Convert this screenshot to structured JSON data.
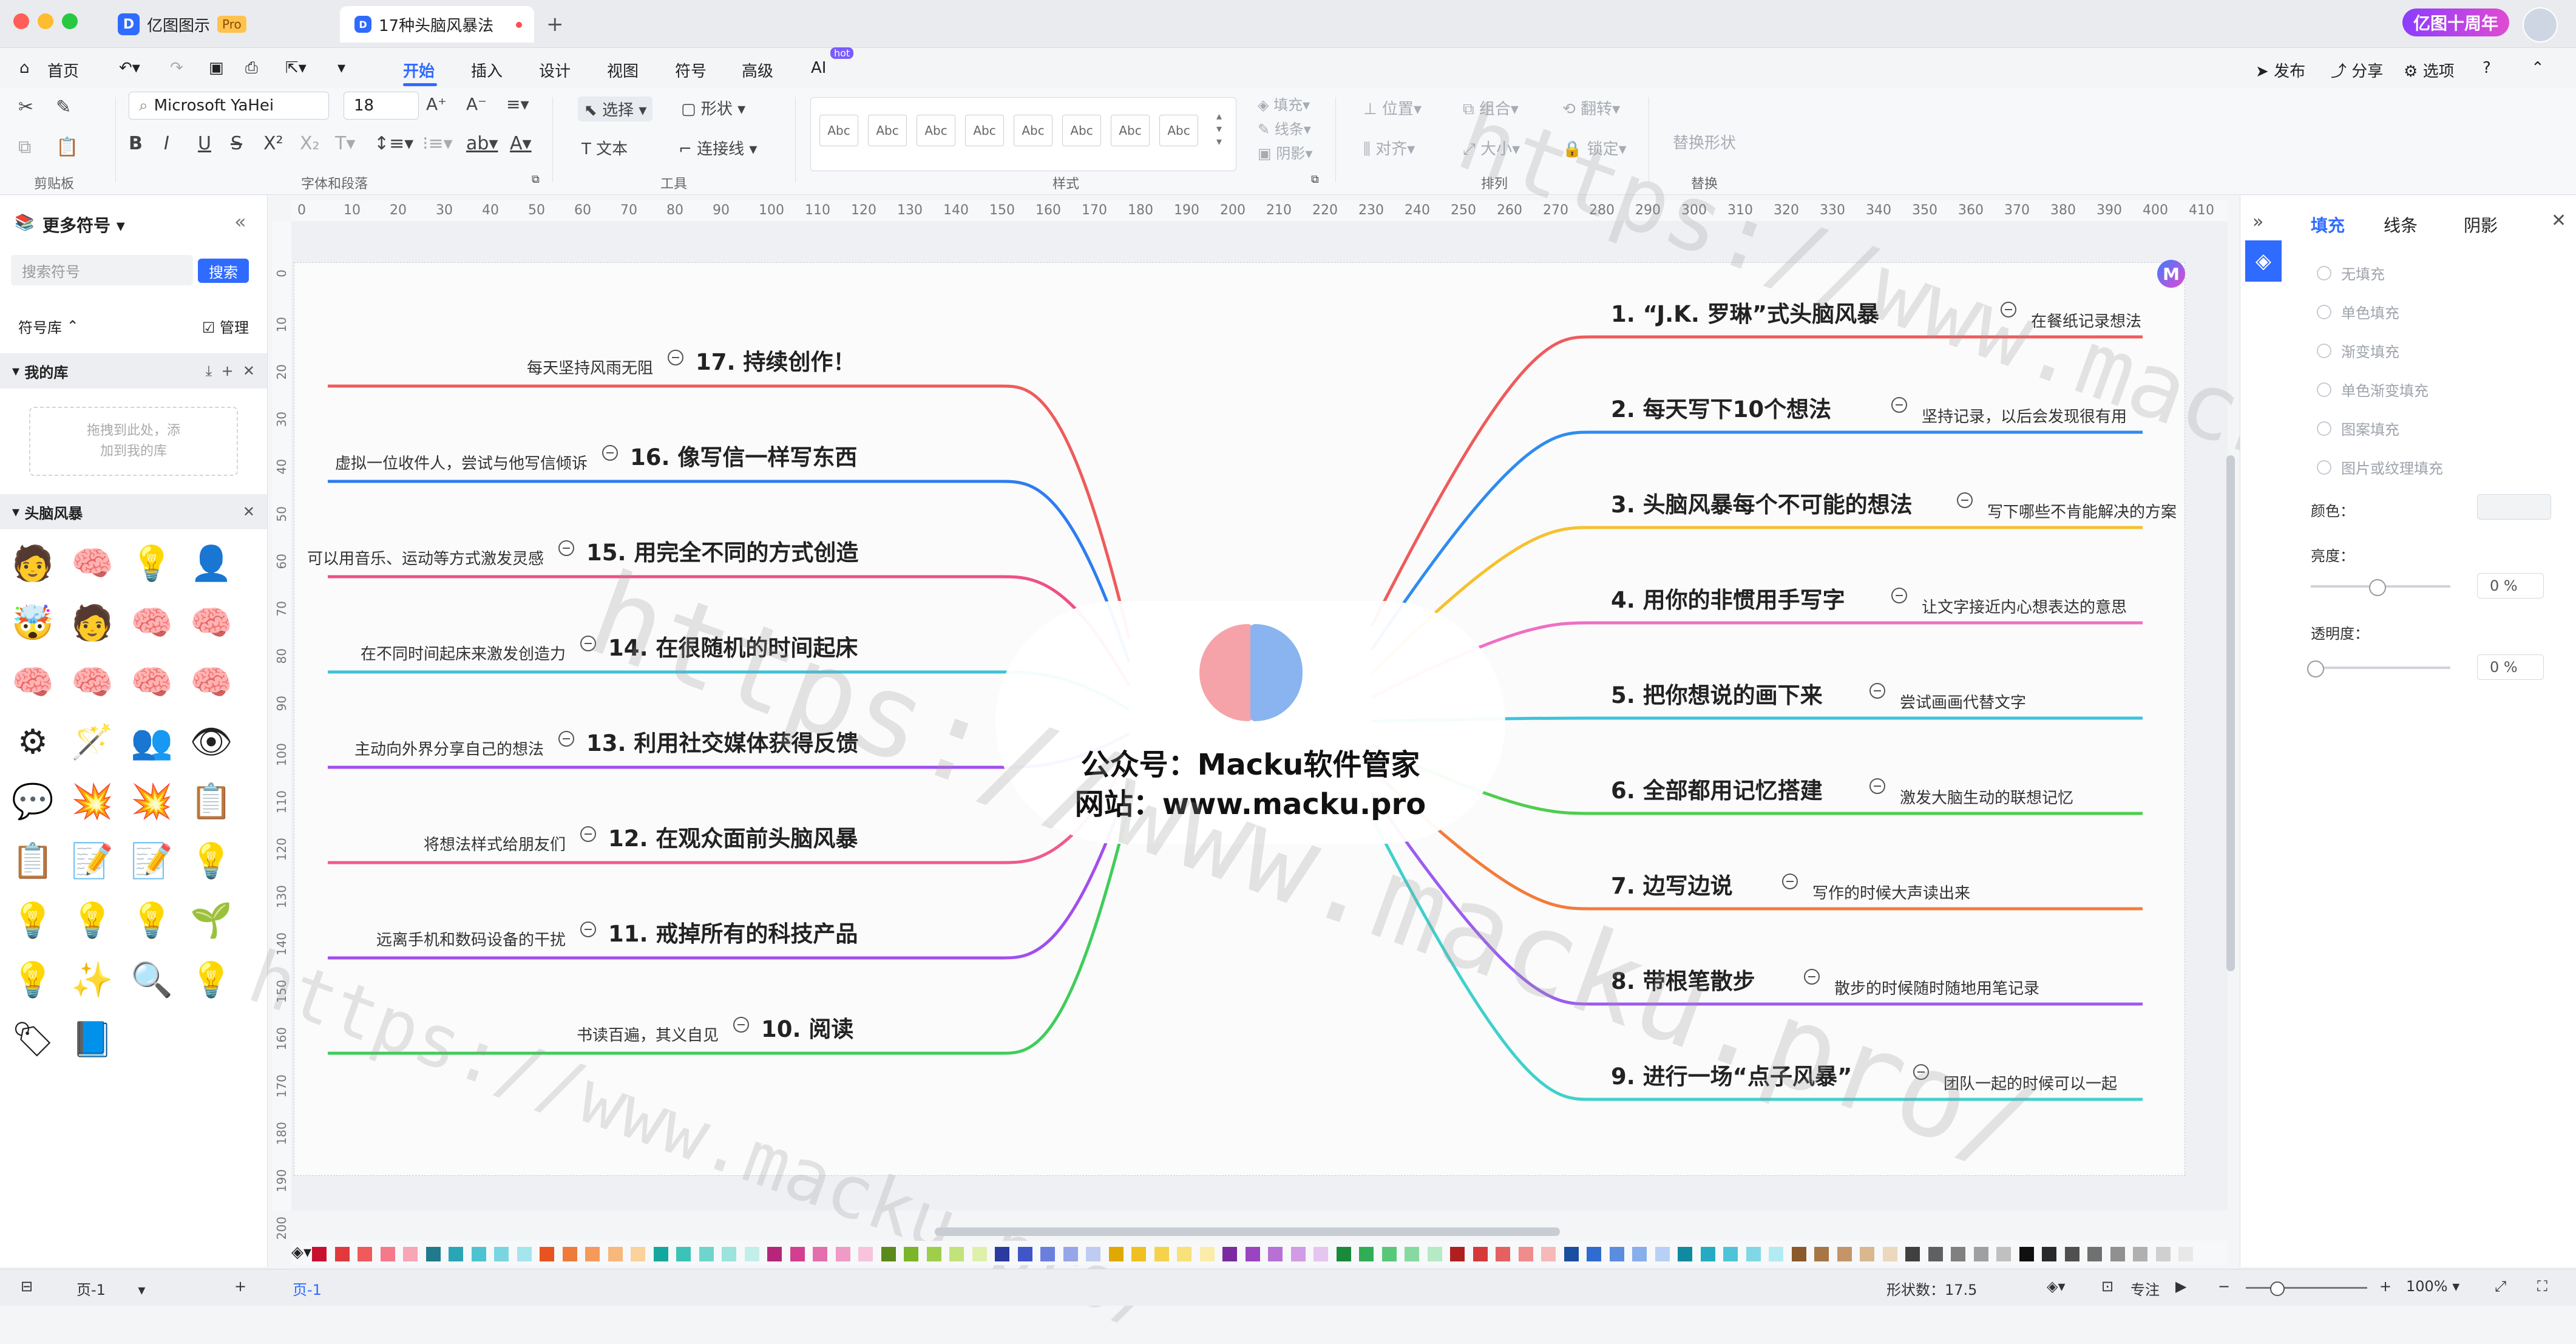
{
  "titlebar": {
    "app_tab": "亿图图示",
    "app_badge": "Pro",
    "doc_tab": "17种头脑风暴法",
    "new_tab": "+",
    "anniversary": "亿图十周年"
  },
  "menu": {
    "home": "首页",
    "tabs": [
      "开始",
      "插入",
      "设计",
      "视图",
      "符号",
      "高级",
      "AI"
    ],
    "ai_badge": "hot",
    "publish": "发布",
    "share": "分享",
    "options": "选项",
    "help": "?"
  },
  "ribbon": {
    "groups": {
      "clipboard": "剪贴板",
      "font_para": "字体和段落",
      "tools": "工具",
      "styles": "样式",
      "arrange": "排列",
      "replace": "替换"
    },
    "font_name": "Microsoft YaHei",
    "font_size": "18",
    "tools": {
      "select": "选择",
      "shape": "形状",
      "text": "文本",
      "connector": "连接线"
    },
    "style_sample": "Abc",
    "fill": "填充",
    "line": "线条",
    "shadow": "阴影",
    "position": "位置",
    "group": "组合",
    "rotate": "翻转",
    "align": "对齐",
    "size": "大小",
    "lock": "锁定",
    "replace_shape": "替换形状"
  },
  "left_panel": {
    "title": "更多符号",
    "search_placeholder": "搜索符号",
    "search_button": "搜索",
    "library": "符号库",
    "manage": "管理",
    "my_library": "我的库",
    "drop_hint_1": "拖拽到此处，添",
    "drop_hint_2": "加到我的库",
    "category": "头脑风暴",
    "symbols": [
      "🧑",
      "🧠",
      "💡",
      "👤",
      "🤯",
      "🧑",
      "🧠",
      "🧠",
      "🧠",
      "🧠",
      "🧠",
      "🧠",
      "⚙",
      "🪄",
      "👥",
      "👁",
      "💬",
      "💥",
      "💥",
      "📋",
      "📋",
      "📝",
      "📝",
      "💡",
      "💡",
      "💡",
      "💡",
      "🌱",
      "💡",
      "✨",
      "🔍",
      "💡",
      "🏷",
      "📘"
    ]
  },
  "ruler": {
    "h": [
      "0",
      "10",
      "20",
      "30",
      "40",
      "50",
      "60",
      "70",
      "80",
      "90",
      "100",
      "110",
      "120",
      "130",
      "140",
      "150",
      "160",
      "170",
      "180",
      "190",
      "200",
      "210",
      "220",
      "230",
      "240",
      "250",
      "260",
      "270",
      "280",
      "290",
      "300",
      "310",
      "320",
      "330",
      "340",
      "350",
      "360",
      "370",
      "380",
      "390",
      "400",
      "410"
    ],
    "v": [
      "0",
      "10",
      "20",
      "30",
      "40",
      "50",
      "60",
      "70",
      "80",
      "90",
      "100",
      "110",
      "120",
      "130",
      "140",
      "150",
      "160",
      "170",
      "180",
      "190",
      "200"
    ]
  },
  "mindmap": {
    "center_line1": "公众号：Macku软件管家",
    "center_line2": "网站：www.macku.pro",
    "right": [
      {
        "title": "1. “J.K. 罗琳”式头脑风暴",
        "note": "在餐纸记录想法",
        "color": "#ef5b5b"
      },
      {
        "title": "2. 每天写下10个想法",
        "note": "坚持记录，以后会发现很有用",
        "color": "#2e8cf0"
      },
      {
        "title": "3. 头脑风暴每个不可能的想法",
        "note": "写下哪些不肯能解决的方案",
        "color": "#f5c12e"
      },
      {
        "title": "4. 用你的非惯用手写字",
        "note": "让文字接近内心想表达的意思",
        "color": "#ee6fc4"
      },
      {
        "title": "5. 把你想说的画下来",
        "note": "尝试画画代替文字",
        "color": "#3cc3d9"
      },
      {
        "title": "6. 全部都用记忆搭建",
        "note": "激发大脑生动的联想记忆",
        "color": "#4fcd4f"
      },
      {
        "title": "7. 边写边说",
        "note": "写作的时候大声读出来",
        "color": "#f47b3a"
      },
      {
        "title": "8. 带根笔散步",
        "note": "散步的时候随时随地用笔记录",
        "color": "#9b5cf0"
      },
      {
        "title": "9. 进行一场“点子风暴”",
        "note": "团队一起的时候可以一起",
        "color": "#3fd0cc"
      }
    ],
    "left": [
      {
        "title": "17. 持续创作！",
        "note": "每天坚持风雨无阻",
        "color": "#ef5b5b"
      },
      {
        "title": "16. 像写信一样写东西",
        "note": "虚拟一位收件人，尝试与他写信倾诉",
        "color": "#2e7cf0"
      },
      {
        "title": "15. 用完全不同的方式创造",
        "note": "可以用音乐、运动等方式激发灵感",
        "color": "#ef4f86"
      },
      {
        "title": "14. 在很随机的时间起床",
        "note": "在不同时间起床来激发创造力",
        "color": "#3cc3d9"
      },
      {
        "title": "13. 利用社交媒体获得反馈",
        "note": "主动向外界分享自己的想法",
        "color": "#a24df0"
      },
      {
        "title": "12. 在观众面前头脑风暴",
        "note": "将想法样式给朋友们",
        "color": "#ef5b8a"
      },
      {
        "title": "11. 戒掉所有的科技产品",
        "note": "远离手机和数码设备的干扰",
        "color": "#a24df0"
      },
      {
        "title": "10. 阅读",
        "note": "书读百遍，其义自见",
        "color": "#3fcd5a"
      }
    ]
  },
  "watermark": "https://www.macku.pro/",
  "right_panel": {
    "tabs": [
      "填充",
      "线条",
      "阴影"
    ],
    "fill_options": [
      "无填充",
      "单色填充",
      "渐变填充",
      "单色渐变填充",
      "图案填充",
      "图片或纹理填充"
    ],
    "color_label": "颜色：",
    "brightness_label": "亮度：",
    "brightness_value": "0 %",
    "opacity_label": "透明度：",
    "opacity_value": "0 %"
  },
  "palette": [
    "#c8102e",
    "#e03a3e",
    "#f05a5a",
    "#f47a8a",
    "#f8a5b5",
    "#1f7a8c",
    "#2aa5b5",
    "#4cc3d0",
    "#7ad5e0",
    "#a5e5ee",
    "#e8531f",
    "#f07a3a",
    "#f59a5a",
    "#f8b87a",
    "#fad29a",
    "#13a89e",
    "#3cc3b8",
    "#6fd5cc",
    "#9be3dc",
    "#c3efea",
    "#b5267a",
    "#d23f91",
    "#e56fad",
    "#f09ac7",
    "#f7c3dd",
    "#5a8a1a",
    "#7ab52a",
    "#9fcf4a",
    "#c2e27a",
    "#def0aa",
    "#2b3a9f",
    "#3f55c8",
    "#6a7fdc",
    "#96a6e8",
    "#c0cbf2",
    "#e0a800",
    "#f0c020",
    "#f5d24a",
    "#f8e07a",
    "#fbeca8",
    "#7a2ba0",
    "#9a44c2",
    "#b870d5",
    "#d19be5",
    "#e6c5f1",
    "#1a8a3a",
    "#2fae55",
    "#58c878",
    "#86d99f",
    "#b5eac5",
    "#b01f1f",
    "#d43a3a",
    "#e56060",
    "#f08c8c",
    "#f7b8b8",
    "#1a4fa0",
    "#2f6bd0",
    "#5a8ce0",
    "#88aeeb",
    "#b8d0f5",
    "#0f8aa0",
    "#24abc3",
    "#4fc4d8",
    "#80d8e6",
    "#b3ebf2",
    "#8a5a2b",
    "#a87545",
    "#c49568",
    "#dab78f",
    "#ecd8bd",
    "#404040",
    "#606060",
    "#808080",
    "#a0a0a0",
    "#c0c0c0",
    "#101010",
    "#2a2a2a",
    "#505050",
    "#707070",
    "#909090",
    "#b0b0b0",
    "#d0d0d0",
    "#e8e8e8"
  ],
  "statusbar": {
    "page_select": "页-1",
    "page_tab": "页-1",
    "add": "+",
    "shape_count": "形状数：17.5",
    "focus": "专注",
    "zoom": "100%"
  }
}
